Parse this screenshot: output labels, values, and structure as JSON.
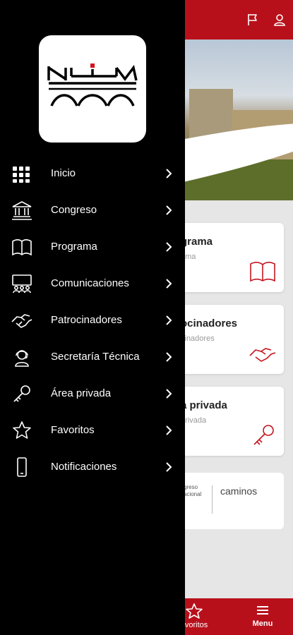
{
  "colors": {
    "brand_red": "#b8101b",
    "drawer_bg": "#000000",
    "text_white": "#ffffff"
  },
  "drawer": {
    "menu": [
      {
        "label": "Inicio",
        "icon": "grid-icon"
      },
      {
        "label": "Congreso",
        "icon": "institution-icon"
      },
      {
        "label": "Programa",
        "icon": "book-icon"
      },
      {
        "label": "Comunicaciones",
        "icon": "presentation-icon"
      },
      {
        "label": "Patrocinadores",
        "icon": "handshake-icon"
      },
      {
        "label": "Secretaría Técnica",
        "icon": "support-agent-icon"
      },
      {
        "label": "Área privada",
        "icon": "key-icon"
      },
      {
        "label": "Favoritos",
        "icon": "star-icon"
      },
      {
        "label": "Notificaciones",
        "icon": "phone-icon"
      }
    ]
  },
  "background": {
    "cards": [
      {
        "title": "grama",
        "subtitle": "ama",
        "icon": "book-icon"
      },
      {
        "title": "ocinadores",
        "subtitle": "cinadores",
        "icon": "handshake-icon"
      },
      {
        "title": "a privada",
        "subtitle": "privada",
        "icon": "key-icon"
      }
    ],
    "logos": {
      "left_text": "greso\nacional",
      "right_text": "caminos"
    },
    "bottom_nav": {
      "favoritos": "avoritos",
      "menu": "Menu"
    }
  }
}
